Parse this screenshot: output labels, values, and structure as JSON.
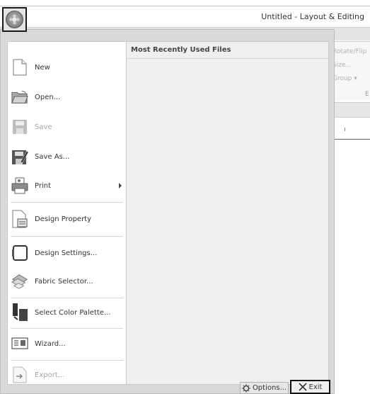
{
  "window": {
    "title": "Untitled - Layout & Editing"
  },
  "ribbon": {
    "rotate_flip": "Rotate/Flip",
    "size": "Size...",
    "group": "Group ▾",
    "group_label": "E"
  },
  "menu": {
    "items": [
      {
        "label": "New",
        "icon": "new-document-icon"
      },
      {
        "label": "Open...",
        "icon": "open-folder-icon"
      },
      {
        "label": "Save",
        "icon": "save-icon",
        "disabled": true
      },
      {
        "label": "Save As...",
        "icon": "save-as-icon"
      },
      {
        "label": "Print",
        "icon": "printer-icon",
        "submenu": true
      },
      {
        "label": "Design Property",
        "icon": "design-property-icon"
      },
      {
        "label": "Design Settings...",
        "icon": "design-settings-icon"
      },
      {
        "label": "Fabric Selector...",
        "icon": "fabric-selector-icon"
      },
      {
        "label": "Select Color Palette...",
        "icon": "color-palette-icon"
      },
      {
        "label": "Wizard...",
        "icon": "wizard-icon"
      },
      {
        "label": "Export...",
        "icon": "export-icon",
        "disabled": true
      }
    ]
  },
  "mru": {
    "title": "Most Recently Used Files"
  },
  "footer": {
    "options_label": "Options...",
    "exit_label": "Exit"
  },
  "colors": {
    "frame": "#d9d9d9",
    "panel": "#efefef",
    "disabled_text": "#a5a5a5",
    "highlight_border": "#111111"
  }
}
